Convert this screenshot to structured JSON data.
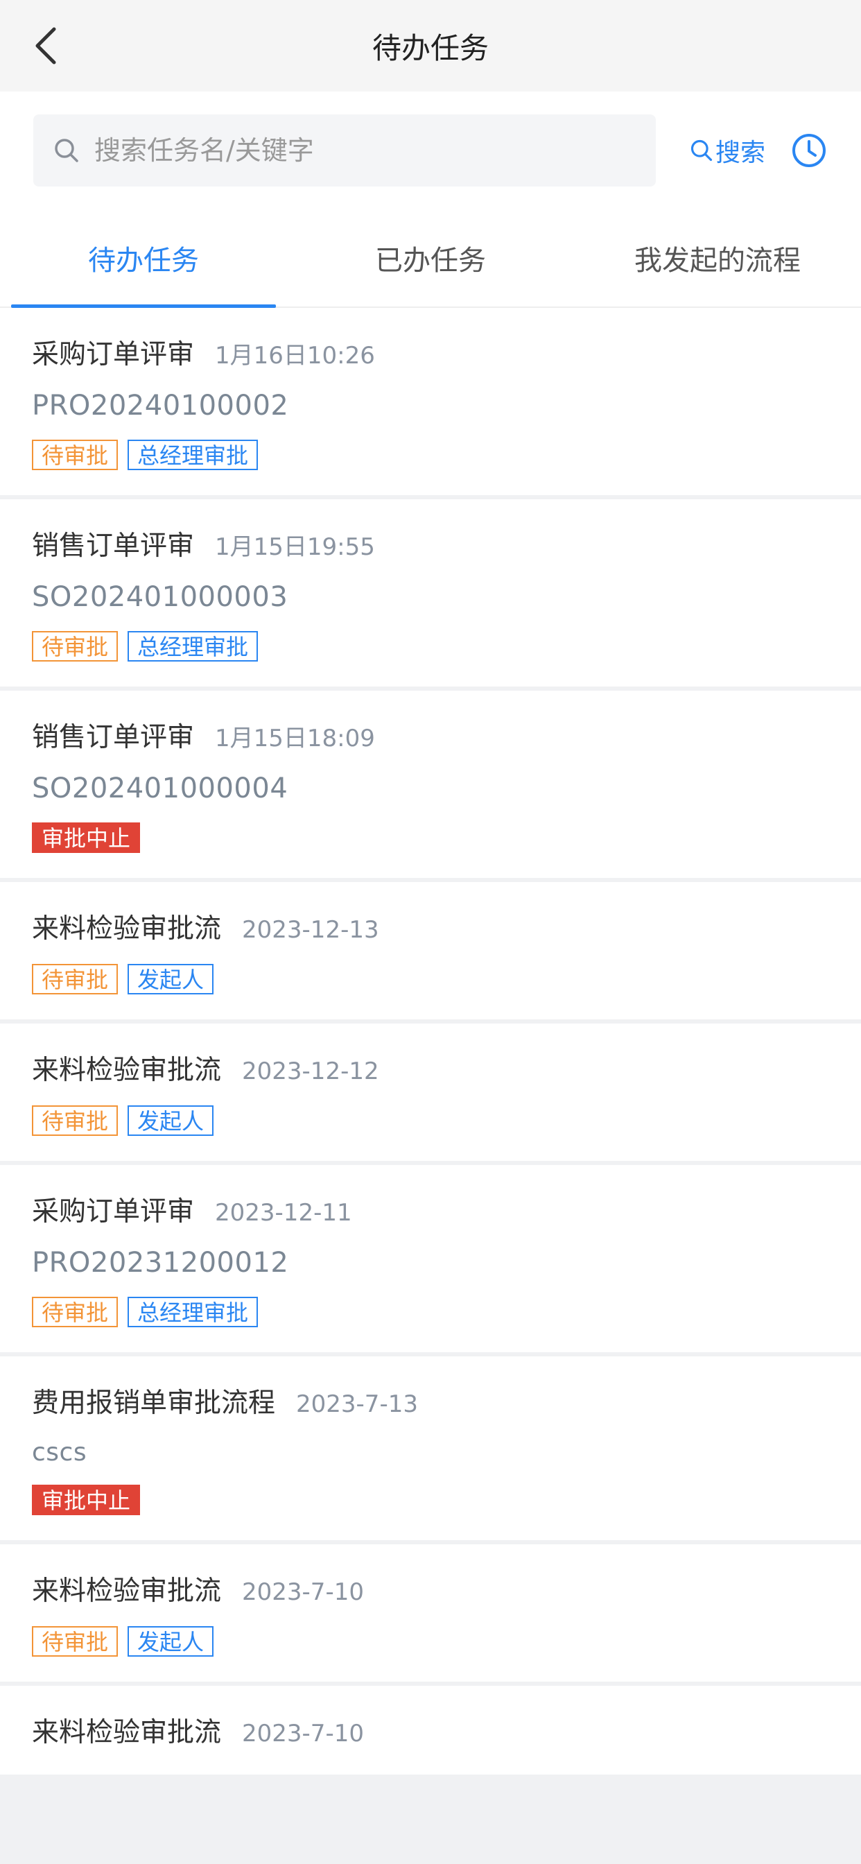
{
  "header": {
    "title": "待办任务"
  },
  "search": {
    "placeholder": "搜索任务名/关键字",
    "button_label": "搜索"
  },
  "tabs": [
    {
      "label": "待办任务",
      "active": true
    },
    {
      "label": "已办任务",
      "active": false
    },
    {
      "label": "我发起的流程",
      "active": false
    }
  ],
  "colors": {
    "accent": "#2a86f2",
    "pending": "#f39437",
    "stopped": "#e04336"
  },
  "items": [
    {
      "title": "采购订单评审",
      "time": "1月16日10:26",
      "code": "PRO20240100002",
      "tags": [
        {
          "text": "待审批",
          "style": "orange"
        },
        {
          "text": "总经理审批",
          "style": "blue"
        }
      ]
    },
    {
      "title": "销售订单评审",
      "time": "1月15日19:55",
      "code": "SO202401000003",
      "tags": [
        {
          "text": "待审批",
          "style": "orange"
        },
        {
          "text": "总经理审批",
          "style": "blue"
        }
      ]
    },
    {
      "title": "销售订单评审",
      "time": "1月15日18:09",
      "code": "SO202401000004",
      "tags": [
        {
          "text": "审批中止",
          "style": "red"
        }
      ]
    },
    {
      "title": "来料检验审批流",
      "time": "2023-12-13",
      "code": "",
      "tags": [
        {
          "text": "待审批",
          "style": "orange"
        },
        {
          "text": "发起人",
          "style": "blue"
        }
      ]
    },
    {
      "title": "来料检验审批流",
      "time": "2023-12-12",
      "code": "",
      "tags": [
        {
          "text": "待审批",
          "style": "orange"
        },
        {
          "text": "发起人",
          "style": "blue"
        }
      ]
    },
    {
      "title": "采购订单评审",
      "time": "2023-12-11",
      "code": "PRO20231200012",
      "tags": [
        {
          "text": "待审批",
          "style": "orange"
        },
        {
          "text": "总经理审批",
          "style": "blue"
        }
      ]
    },
    {
      "title": "费用报销单审批流程",
      "time": "2023-7-13",
      "code": "cscs",
      "tags": [
        {
          "text": "审批中止",
          "style": "red"
        }
      ]
    },
    {
      "title": "来料检验审批流",
      "time": "2023-7-10",
      "code": "",
      "tags": [
        {
          "text": "待审批",
          "style": "orange"
        },
        {
          "text": "发起人",
          "style": "blue"
        }
      ]
    },
    {
      "title": "来料检验审批流",
      "time": "2023-7-10",
      "code": "",
      "tags": []
    }
  ]
}
